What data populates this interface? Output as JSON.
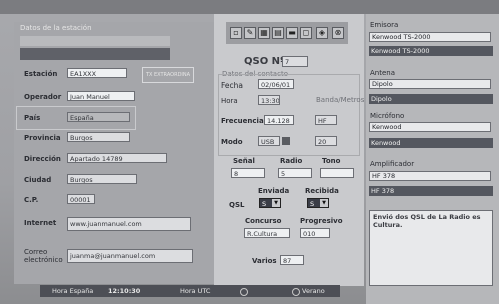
{
  "station": {
    "section_title": "Datos de la estación",
    "callsign_stamp": "TX EXTRAORDINA",
    "fields": [
      {
        "label": "Estación",
        "value": "EA1XXX"
      },
      {
        "label": "Operador",
        "value": "Juan Manuel"
      },
      {
        "label": "País",
        "value": "España"
      },
      {
        "label": "Provincia",
        "value": "Burgos"
      },
      {
        "label": "Dirección",
        "value": "Apartado 14789"
      },
      {
        "label": "Ciudad",
        "value": "Burgos"
      },
      {
        "label": "C.P.",
        "value": "00001"
      },
      {
        "label": "Internet",
        "value": "www.juanmanuel.com"
      },
      {
        "label": "Correo electrónico",
        "value": "juanma@juanmanuel.com"
      }
    ]
  },
  "qso": {
    "title": "QSO Nº",
    "number": "7",
    "contact_section": "Datos del contacto",
    "fecha_label": "Fecha",
    "fecha": "02/06/01",
    "hora_label": "Hora",
    "hora": "13:30",
    "frecuencia_label": "Frecuencia",
    "frecuencia": "14.128",
    "modo_label": "Modo",
    "modo": "USB",
    "banda_label": "Banda/Metros",
    "banda": "HF",
    "metros": "20",
    "senal_label": "Señal",
    "senal": "8",
    "radio_label": "Radio",
    "radio": "5",
    "tono_label": "Tono",
    "tono": "",
    "qsl_label": "QSL",
    "enviada_label": "Enviada",
    "enviada": "S",
    "recibida_label": "Recibida",
    "recibida": "S",
    "concurso_label": "Concurso",
    "concurso": "R.Cultura",
    "progresivo_label": "Progresivo",
    "progresivo": "010",
    "varios_label": "Varios",
    "varios": "87"
  },
  "equipment": {
    "emisora_label": "Emisora",
    "emisora": "Kenwood TS-2000",
    "emisora_bar": "Kenwood TS-2000",
    "antena_label": "Antena",
    "antena": "Dipolo",
    "antena_bar": "Dipolo",
    "microfono_label": "Micrófono",
    "microfono": "Kenwood",
    "microfono_bar": "Kenwood",
    "amplificador_label": "Amplificador",
    "amplificador": "HF 378",
    "amplificador_bar": "HF 378",
    "notes": "Envió dos QSL de La Radio es Cultura."
  },
  "statusbar": {
    "hora_espana_label": "Hora España",
    "hora_espana": "12:10:30",
    "hora_utc_label": "Hora UTC",
    "utc_radio": "",
    "verano_label": "Verano"
  },
  "colors": {
    "accent": "#4a4c53",
    "background": "#a8a9ad"
  }
}
